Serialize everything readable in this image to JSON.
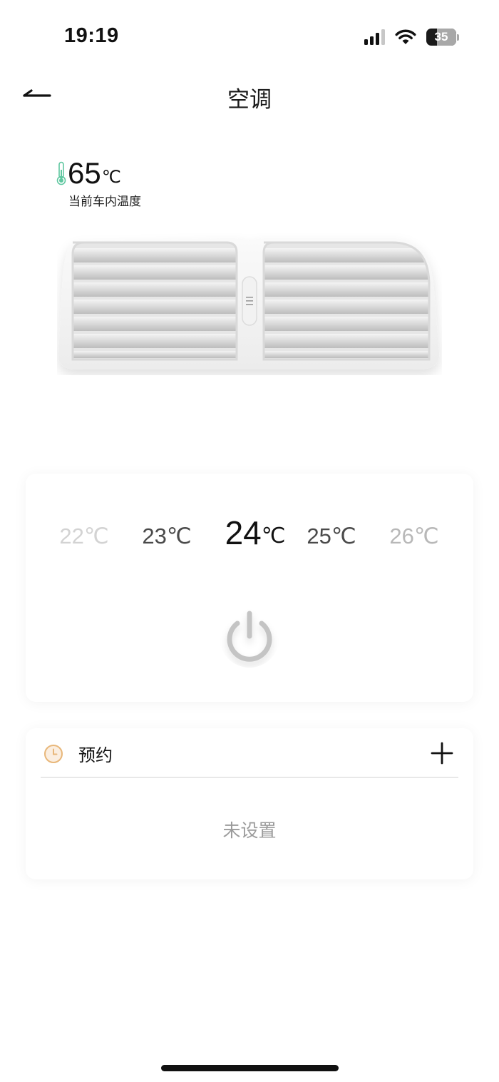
{
  "status_bar": {
    "time": "19:19",
    "battery_level": "35",
    "signal_bars": 4,
    "signal_active": 3,
    "icons": [
      "signal-icon",
      "wifi-icon",
      "battery-icon"
    ]
  },
  "nav": {
    "title": "空调",
    "back_icon": "back-arrow-icon"
  },
  "current_temp": {
    "value": "65",
    "unit": "℃",
    "label": "当前车内温度",
    "icon": "thermometer-icon",
    "icon_color": "#5fc7a0"
  },
  "temperature_picker": {
    "options": [
      {
        "value": "22",
        "unit": "℃"
      },
      {
        "value": "23",
        "unit": "℃"
      },
      {
        "value": "24",
        "unit": "℃"
      },
      {
        "value": "25",
        "unit": "℃"
      },
      {
        "value": "26",
        "unit": "℃"
      }
    ],
    "selected_index": 2,
    "power_icon": "power-icon",
    "power_state": "off"
  },
  "schedule": {
    "title": "预约",
    "empty_text": "未设置",
    "icon": "clock-icon",
    "icon_color": "#e8b77a",
    "add_icon": "plus-icon"
  },
  "colors": {
    "text_primary": "#111111",
    "text_muted": "#9b9b9b",
    "power_gray": "#c4c4c4"
  }
}
